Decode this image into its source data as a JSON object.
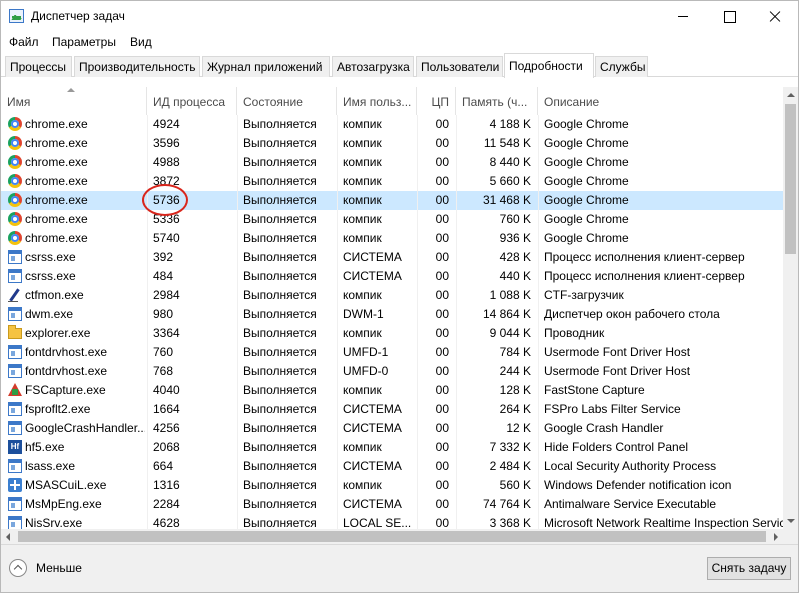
{
  "window": {
    "title": "Диспетчер задач"
  },
  "menu": [
    "Файл",
    "Параметры",
    "Вид"
  ],
  "tabs": [
    {
      "label": "Процессы",
      "active": false
    },
    {
      "label": "Производительность",
      "active": false
    },
    {
      "label": "Журнал приложений",
      "active": false
    },
    {
      "label": "Автозагрузка",
      "active": false
    },
    {
      "label": "Пользователи",
      "active": false
    },
    {
      "label": "Подробности",
      "active": true
    },
    {
      "label": "Службы",
      "active": false
    }
  ],
  "columns": {
    "name": "Имя",
    "pid": "ИД процесса",
    "status": "Состояние",
    "user": "Имя польз...",
    "cpu": "ЦП",
    "memory": "Память (ч...",
    "description": "Описание"
  },
  "rows": [
    {
      "icon": "chrome-icon",
      "name": "chrome.exe",
      "pid": "4924",
      "status": "Выполняется",
      "user": "компик",
      "cpu": "00",
      "memory": "4 188 K",
      "description": "Google Chrome",
      "selected": false
    },
    {
      "icon": "chrome-icon",
      "name": "chrome.exe",
      "pid": "3596",
      "status": "Выполняется",
      "user": "компик",
      "cpu": "00",
      "memory": "11 548 K",
      "description": "Google Chrome",
      "selected": false
    },
    {
      "icon": "chrome-icon",
      "name": "chrome.exe",
      "pid": "4988",
      "status": "Выполняется",
      "user": "компик",
      "cpu": "00",
      "memory": "8 440 K",
      "description": "Google Chrome",
      "selected": false
    },
    {
      "icon": "chrome-icon",
      "name": "chrome.exe",
      "pid": "3872",
      "status": "Выполняется",
      "user": "компик",
      "cpu": "00",
      "memory": "5 660 K",
      "description": "Google Chrome",
      "selected": false
    },
    {
      "icon": "chrome-icon",
      "name": "chrome.exe",
      "pid": "5736",
      "status": "Выполняется",
      "user": "компик",
      "cpu": "00",
      "memory": "31 468 K",
      "description": "Google Chrome",
      "selected": true
    },
    {
      "icon": "chrome-icon",
      "name": "chrome.exe",
      "pid": "5336",
      "status": "Выполняется",
      "user": "компик",
      "cpu": "00",
      "memory": "760 K",
      "description": "Google Chrome",
      "selected": false
    },
    {
      "icon": "chrome-icon",
      "name": "chrome.exe",
      "pid": "5740",
      "status": "Выполняется",
      "user": "компик",
      "cpu": "00",
      "memory": "936 K",
      "description": "Google Chrome",
      "selected": false
    },
    {
      "icon": "window-icon",
      "name": "csrss.exe",
      "pid": "392",
      "status": "Выполняется",
      "user": "СИСТЕМА",
      "cpu": "00",
      "memory": "428 K",
      "description": "Процесс исполнения клиент-сервер",
      "selected": false
    },
    {
      "icon": "window-icon",
      "name": "csrss.exe",
      "pid": "484",
      "status": "Выполняется",
      "user": "СИСТЕМА",
      "cpu": "00",
      "memory": "440 K",
      "description": "Процесс исполнения клиент-сервер",
      "selected": false
    },
    {
      "icon": "pen-icon",
      "name": "ctfmon.exe",
      "pid": "2984",
      "status": "Выполняется",
      "user": "компик",
      "cpu": "00",
      "memory": "1 088 K",
      "description": "CTF-загрузчик",
      "selected": false
    },
    {
      "icon": "window-icon",
      "name": "dwm.exe",
      "pid": "980",
      "status": "Выполняется",
      "user": "DWM-1",
      "cpu": "00",
      "memory": "14 864 K",
      "description": "Диспетчер окон рабочего стола",
      "selected": false
    },
    {
      "icon": "folder-icon",
      "name": "explorer.exe",
      "pid": "3364",
      "status": "Выполняется",
      "user": "компик",
      "cpu": "00",
      "memory": "9 044 K",
      "description": "Проводник",
      "selected": false
    },
    {
      "icon": "window-icon",
      "name": "fontdrvhost.exe",
      "pid": "760",
      "status": "Выполняется",
      "user": "UMFD-1",
      "cpu": "00",
      "memory": "784 K",
      "description": "Usermode Font Driver Host",
      "selected": false
    },
    {
      "icon": "window-icon",
      "name": "fontdrvhost.exe",
      "pid": "768",
      "status": "Выполняется",
      "user": "UMFD-0",
      "cpu": "00",
      "memory": "244 K",
      "description": "Usermode Font Driver Host",
      "selected": false
    },
    {
      "icon": "faststone-icon",
      "name": "FSCapture.exe",
      "pid": "4040",
      "status": "Выполняется",
      "user": "компик",
      "cpu": "00",
      "memory": "128 K",
      "description": "FastStone Capture",
      "selected": false
    },
    {
      "icon": "window-icon",
      "name": "fsproflt2.exe",
      "pid": "1664",
      "status": "Выполняется",
      "user": "СИСТЕМА",
      "cpu": "00",
      "memory": "264 K",
      "description": "FSPro Labs Filter Service",
      "selected": false
    },
    {
      "icon": "window-icon",
      "name": "GoogleCrashHandler...",
      "pid": "4256",
      "status": "Выполняется",
      "user": "СИСТЕМА",
      "cpu": "00",
      "memory": "12 K",
      "description": "Google Crash Handler",
      "selected": false
    },
    {
      "icon": "hf-icon",
      "name": "hf5.exe",
      "pid": "2068",
      "status": "Выполняется",
      "user": "компик",
      "cpu": "00",
      "memory": "7 332 K",
      "description": "Hide Folders Control Panel",
      "selected": false
    },
    {
      "icon": "window-icon",
      "name": "lsass.exe",
      "pid": "664",
      "status": "Выполняется",
      "user": "СИСТЕМА",
      "cpu": "00",
      "memory": "2 484 K",
      "description": "Local Security Authority Process",
      "selected": false
    },
    {
      "icon": "defender-icon",
      "name": "MSASCuiL.exe",
      "pid": "1316",
      "status": "Выполняется",
      "user": "компик",
      "cpu": "00",
      "memory": "560 K",
      "description": "Windows Defender notification icon",
      "selected": false
    },
    {
      "icon": "window-icon",
      "name": "MsMpEng.exe",
      "pid": "2284",
      "status": "Выполняется",
      "user": "СИСТЕМА",
      "cpu": "00",
      "memory": "74 764 K",
      "description": "Antimalware Service Executable",
      "selected": false
    },
    {
      "icon": "window-icon",
      "name": "NisSrv.exe",
      "pid": "4628",
      "status": "Выполняется",
      "user": "LOCAL SE...",
      "cpu": "00",
      "memory": "3 368 K",
      "description": "Microsoft Network Realtime Inspection Servic",
      "selected": false
    }
  ],
  "footer": {
    "less_label": "Меньше",
    "end_task_label": "Снять задачу"
  },
  "colors": {
    "selected_row": "#cce8ff",
    "highlight_circle": "#d9261c"
  }
}
